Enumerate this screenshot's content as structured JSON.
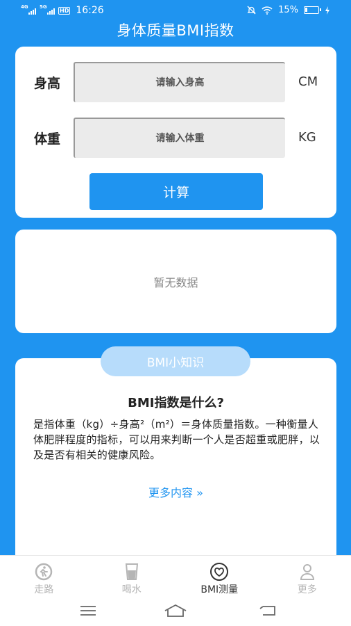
{
  "status_bar": {
    "network1": "4G",
    "network2": "5G",
    "hd": "HD",
    "time": "16:26",
    "battery_pct": "15%"
  },
  "app": {
    "title": "身体质量BMI指数"
  },
  "form": {
    "height_label": "身高",
    "height_placeholder": "请输入身高",
    "height_unit": "CM",
    "weight_label": "体重",
    "weight_placeholder": "请输入体重",
    "weight_unit": "KG",
    "calc_button": "计算"
  },
  "result": {
    "empty_text": "暂无数据"
  },
  "knowledge": {
    "pill": "BMI小知识",
    "heading": "BMI指数是什么?",
    "body": "是指体重（kg）÷身高²（m²）＝身体质量指数。一种衡量人体肥胖程度的指标，可以用来判断一个人是否超重或肥胖，以及是否有相关的健康风险。",
    "more_link": "更多内容 »"
  },
  "tabs": [
    {
      "label": "走路",
      "icon": "walk-icon"
    },
    {
      "label": "喝水",
      "icon": "water-cup-icon"
    },
    {
      "label": "BMI测量",
      "icon": "heart-icon",
      "active": true
    },
    {
      "label": "更多",
      "icon": "person-icon"
    }
  ],
  "colors": {
    "primary": "#1f94f0",
    "pill": "#b7dcfb"
  }
}
